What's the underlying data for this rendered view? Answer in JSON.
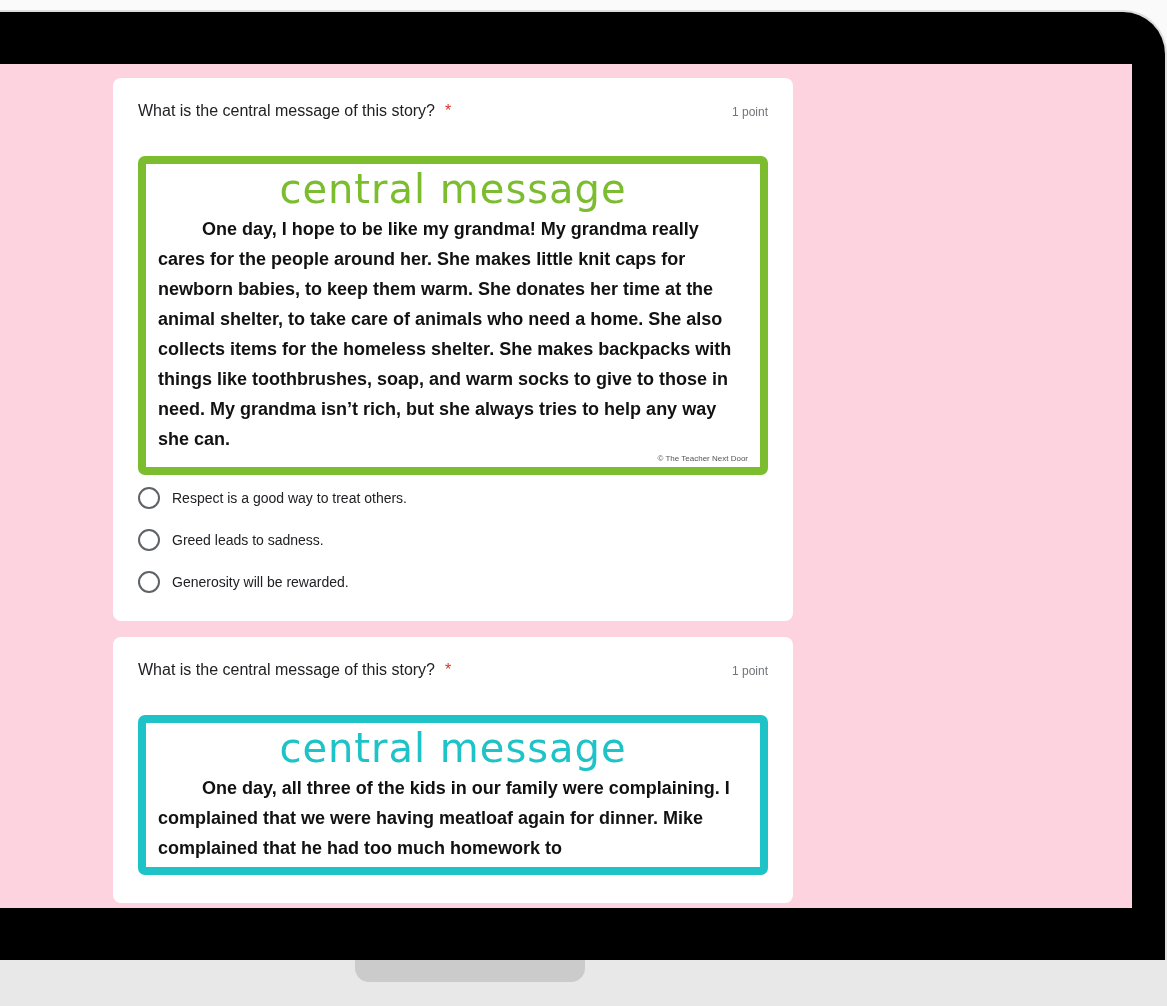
{
  "questions": [
    {
      "title": "What is the central message of this story?",
      "required_mark": "*",
      "points": "1 point",
      "card": {
        "color": "#7cbd2f",
        "heading": "central message",
        "story": "One day, I hope to be like my grandma! My grandma really cares for the people around her. She makes little knit caps for newborn babies, to keep them warm. She donates her time at the animal shelter, to take care of animals who need a home. She also collects items for the homeless shelter. She makes backpacks with things like toothbrushes, soap, and warm socks to give to those in need. My grandma isn’t rich, but she always tries to help any way she can.",
        "credit": "© The Teacher Next Door"
      },
      "options": [
        {
          "label": "Respect is a good way to treat others.",
          "selected": false
        },
        {
          "label": "Greed leads to sadness.",
          "selected": false
        },
        {
          "label": "Generosity will be rewarded.",
          "selected": false
        }
      ]
    },
    {
      "title": "What is the central message of this story?",
      "required_mark": "*",
      "points": "1 point",
      "card": {
        "color": "#1ec3c8",
        "heading": "central message",
        "story": "One day, all three of the kids in our family were complaining. I complained that we were having meatloaf again for dinner. Mike complained that he had too much homework to"
      }
    }
  ]
}
